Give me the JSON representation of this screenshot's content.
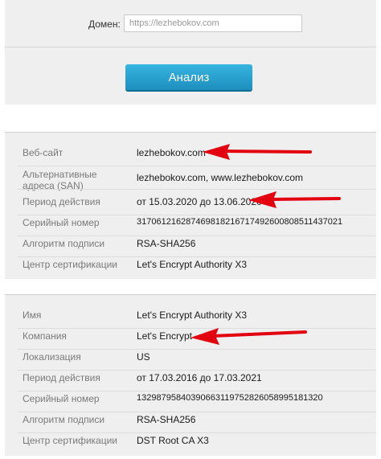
{
  "form": {
    "domain_label": "Домен:",
    "domain_placeholder": "https://lezhebokov.com",
    "analyze_label": "Анализ"
  },
  "site_cert": {
    "rows": [
      {
        "label": "Веб-сайт",
        "value": "lezhebokov.com"
      },
      {
        "label": "Альтернативные адреса (SAN)",
        "value": "lezhebokov.com, www.lezhebokov.com"
      },
      {
        "label": "Период действия",
        "value": "от 15.03.2020 до 13.06.2020"
      },
      {
        "label": "Серийный номер",
        "value": "317061216287469818216717492600808511437021"
      },
      {
        "label": "Алгоритм подписи",
        "value": "RSA-SHA256"
      },
      {
        "label": "Центр сертификации",
        "value": "Let's Encrypt Authority X3"
      }
    ]
  },
  "issuer_cert": {
    "rows": [
      {
        "label": "Имя",
        "value": "Let's Encrypt Authority X3"
      },
      {
        "label": "Компания",
        "value": "Let's Encrypt"
      },
      {
        "label": "Локализация",
        "value": "US"
      },
      {
        "label": "Период действия",
        "value": "от 17.03.2016 до 17.03.2021"
      },
      {
        "label": "Серийный номер",
        "value": "13298795840390663119752826058995181320"
      },
      {
        "label": "Алгоритм подписи",
        "value": "RSA-SHA256"
      },
      {
        "label": "Центр сертификации",
        "value": "DST Root CA X3"
      }
    ]
  },
  "colors": {
    "panel_bg": "#efefef",
    "button": "#2aa3d4",
    "arrow": "#e3000f"
  }
}
